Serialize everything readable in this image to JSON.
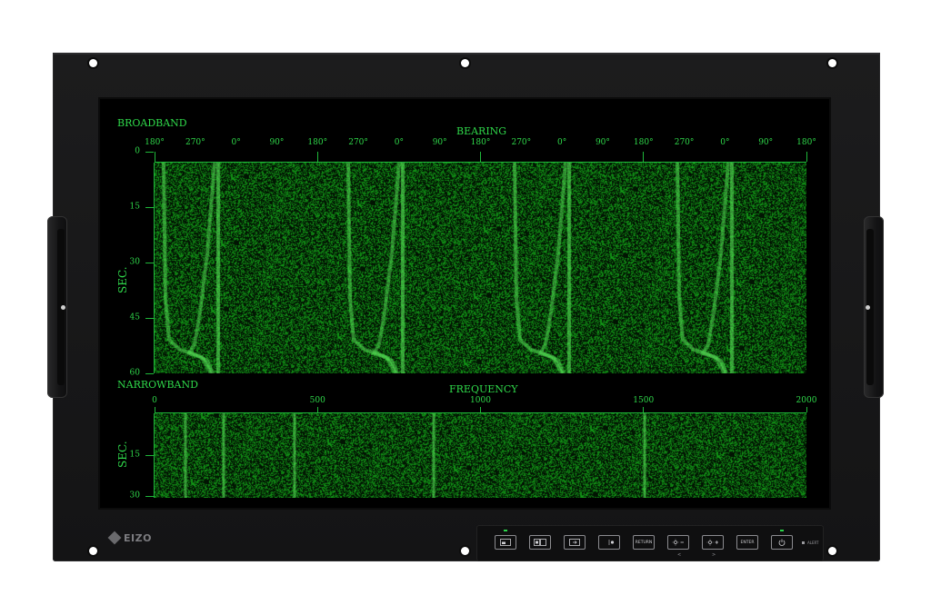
{
  "monitor": {
    "brand": "EIZO",
    "alert_label": "ALERT"
  },
  "broadband": {
    "title": "BROADBAND",
    "axis_title": "BEARING",
    "bearing_ticks": [
      "180°",
      "270°",
      "0°",
      "90°",
      "180°",
      "270°",
      "0°",
      "90°",
      "180°",
      "270°",
      "0°",
      "90°",
      "180°",
      "270°",
      "0°",
      "90°",
      "180°"
    ],
    "y_axis_title": "SEC.",
    "y_ticks": [
      "0",
      "15",
      "30",
      "45",
      "60"
    ]
  },
  "narrowband": {
    "title": "NARROWBAND",
    "axis_title": "FREQUENCY",
    "freq_ticks": [
      "0",
      "500",
      "1000",
      "1500",
      "2000"
    ],
    "y_axis_title": "SEC.",
    "y_ticks": [
      "15",
      "30"
    ]
  },
  "controls": {
    "buttons": [
      {
        "name": "picture-in-picture-button",
        "icon": "pip-icon",
        "label": ""
      },
      {
        "name": "picture-by-picture-button",
        "icon": "pbp-icon",
        "label": ""
      },
      {
        "name": "input-select-button",
        "icon": "input-icon",
        "label": ""
      },
      {
        "name": "day-night-mode-button",
        "icon": "day-night-icon",
        "label": ""
      },
      {
        "name": "return-button",
        "icon": "",
        "label": "RETURN"
      },
      {
        "name": "brightness-down-button",
        "icon": "brightness-minus-icon",
        "label": ""
      },
      {
        "name": "brightness-up-button",
        "icon": "brightness-plus-icon",
        "label": ""
      },
      {
        "name": "enter-button",
        "icon": "",
        "label": "ENTER"
      },
      {
        "name": "power-button",
        "icon": "power-icon",
        "label": ""
      }
    ],
    "arrow_left": "<",
    "arrow_right": ">"
  },
  "colors": {
    "phosphor_green": "#2fd84a",
    "noise_green": "#0e5a18",
    "background": "#000000"
  }
}
